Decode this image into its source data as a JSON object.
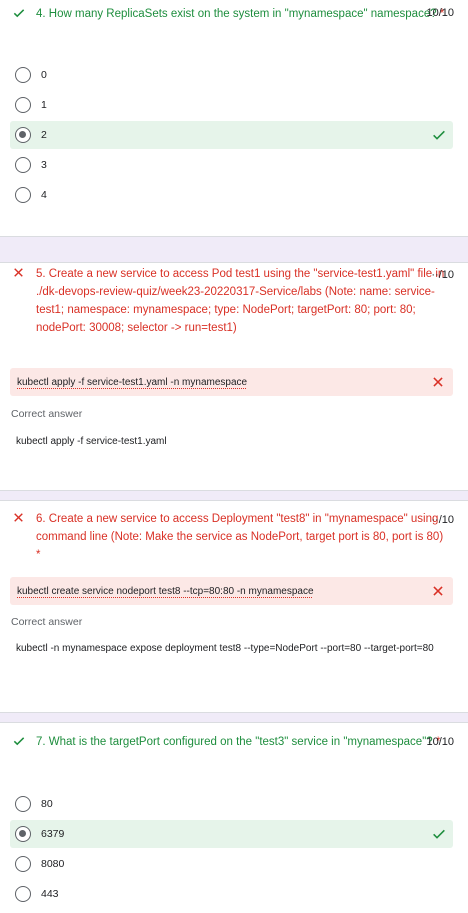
{
  "q4": {
    "title": "4. How many ReplicaSets exist on the system in \"mynamespace\" namespace?",
    "required": "*",
    "score": "10/10",
    "options": [
      "0",
      "1",
      "2",
      "3",
      "4"
    ],
    "selected_index": 2
  },
  "q5": {
    "title": "5. Create a new service to access Pod test1 using the \"service-test1.yaml\" file in ./dk-devops-review-quiz/week23-20220317-Service/labs (Note: name: service-test1; namespace: mynamespace; type: NodePort; targetPort: 80; port: 80; nodePort: 30008; selector -> run=test1)",
    "score": "··/10",
    "response": "kubectl apply -f service-test1.yaml -n mynamespace",
    "correct_label": "Correct answer",
    "correct_answer": "kubectl apply -f service-test1.yaml"
  },
  "q6": {
    "title": "6. Create a new service to access Deployment \"test8\" in \"mynamespace\" using command line (Note: Make the service as NodePort, target port is 80, port is 80)",
    "required": "*",
    "score": "··/10",
    "response": "kubectl create service nodeport test8 --tcp=80:80 -n mynamespace",
    "correct_label": "Correct answer",
    "correct_answer": "kubectl -n mynamespace expose deployment test8 --type=NodePort --port=80 --target-port=80"
  },
  "q7": {
    "title": "7. What is the targetPort configured on the \"test3\" service in \"mynamespace\"?",
    "required": "*",
    "score": "10/10",
    "options": [
      "80",
      "6379",
      "8080",
      "443"
    ],
    "selected_index": 1
  },
  "colors": {
    "correct": "#1e8e3e",
    "incorrect": "#d93025",
    "correct_bg": "#e6f4ea",
    "incorrect_bg": "#fce8e6"
  }
}
